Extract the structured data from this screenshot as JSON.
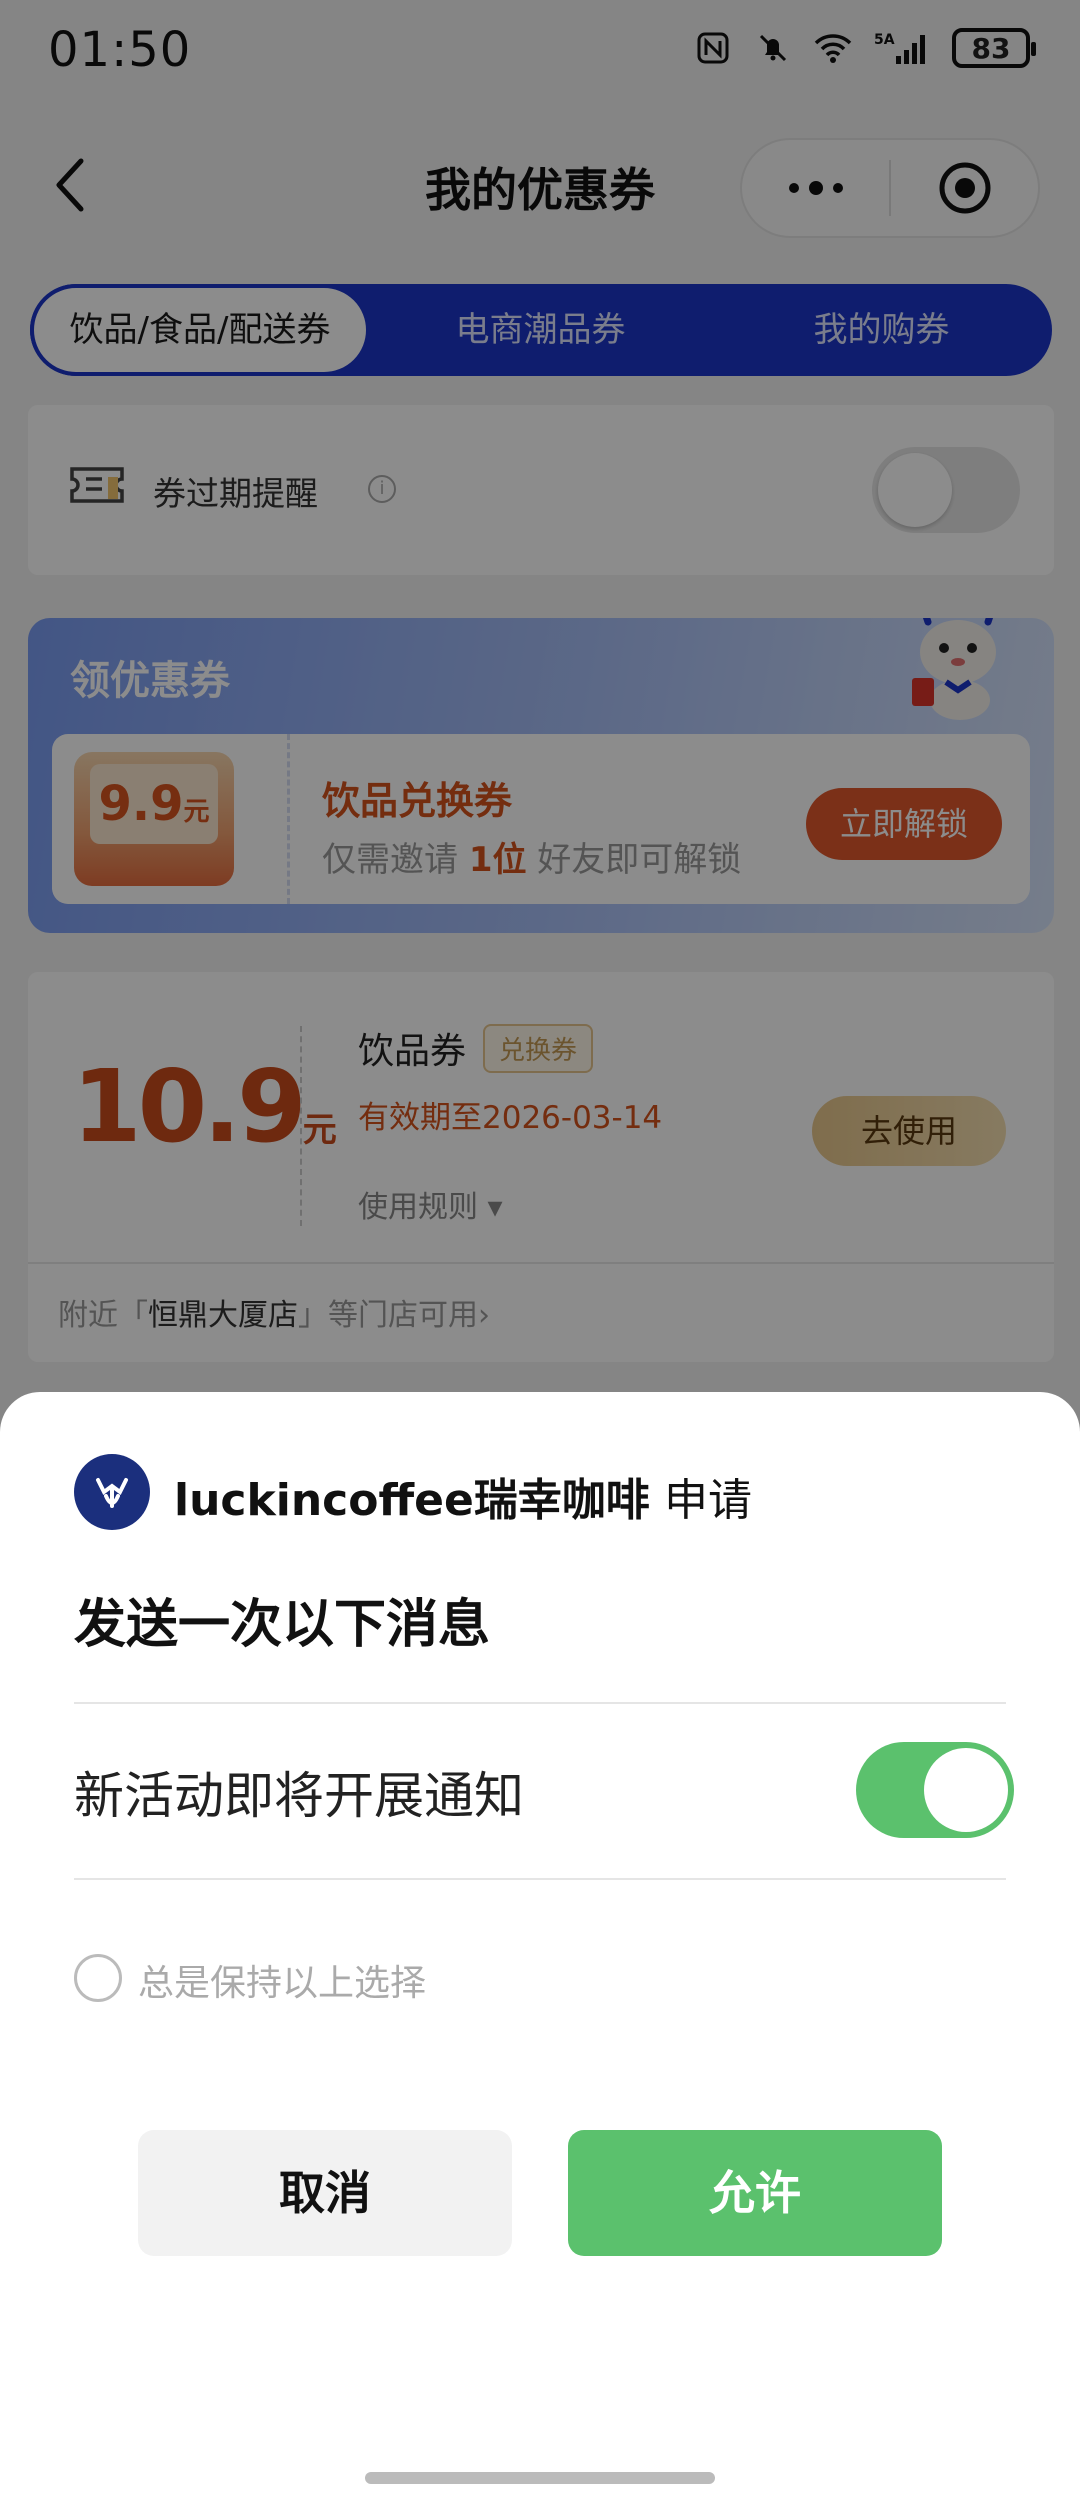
{
  "status_bar": {
    "time": "01:50",
    "battery": "83",
    "network": "5A"
  },
  "nav": {
    "title": "我的优惠券"
  },
  "tabs": [
    {
      "label": "饮品/食品/配送券",
      "active": true
    },
    {
      "label": "电商潮品券",
      "active": false
    },
    {
      "label": "我的购券",
      "active": false
    }
  ],
  "reminder": {
    "label": "券过期提醒",
    "enabled": false
  },
  "promo": {
    "title": "领优惠券",
    "coupon_value": "9.9",
    "coupon_unit": "元",
    "name": "饮品兑换券",
    "desc_prefix": "仅需邀请",
    "desc_count": "1位",
    "desc_suffix": "好友即可解锁",
    "button": "立即解锁"
  },
  "coupon": {
    "price": "10.9",
    "unit": "元",
    "name": "饮品券",
    "badge": "兑换券",
    "validity": "有效期至2026-03-14",
    "rules": "使用规则",
    "use_button": "去使用",
    "stores_prefix": "附近「",
    "stores_name": "恒鼎大厦店",
    "stores_suffix": "」等门店可用"
  },
  "sheet": {
    "app_name": "luckincoffee瑞幸咖啡",
    "request": "申请",
    "heading": "发送一次以下消息",
    "permission": "新活动即将开展通知",
    "permission_enabled": true,
    "keep_choice": "总是保持以上选择",
    "cancel": "取消",
    "allow": "允许"
  },
  "colors": {
    "brand_blue": "#1d36c8",
    "accent_orange": "#d4521c",
    "allow_green": "#5bc16d"
  }
}
